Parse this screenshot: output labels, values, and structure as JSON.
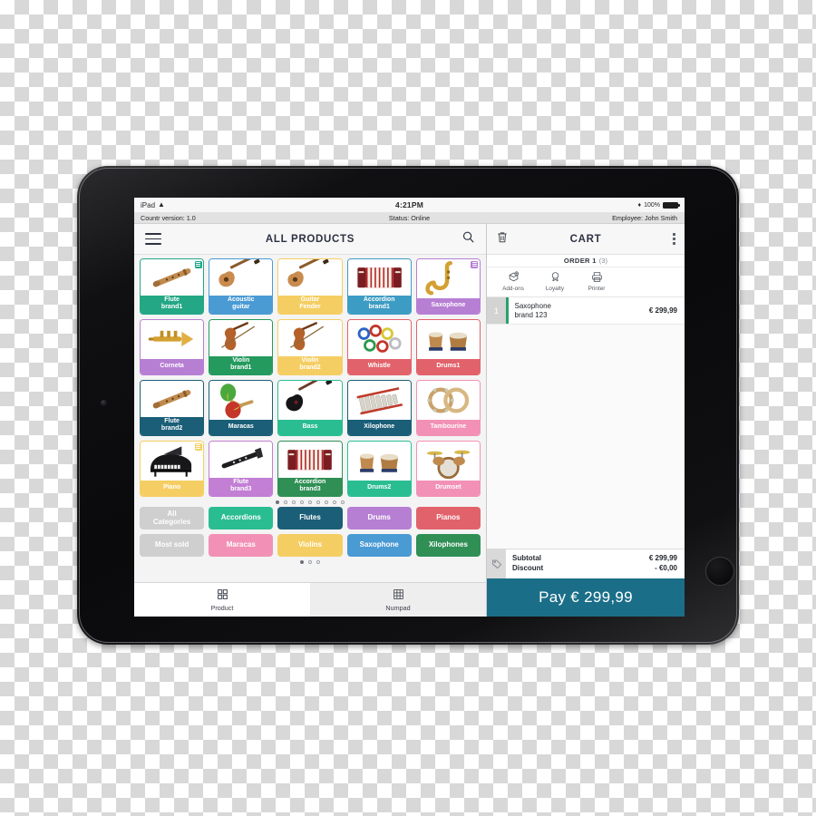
{
  "status_bar": {
    "device": "iPad",
    "wifi_icon": "wifi-icon",
    "time": "4:21PM",
    "bluetooth_icon": "bluetooth-icon",
    "battery_percent": "100%"
  },
  "info_bar": {
    "version": "Countr version: 1.0",
    "status": "Status: Online",
    "employee": "Employee: John Smith"
  },
  "products_panel": {
    "menu_icon": "hamburger-menu-icon",
    "title": "ALL PRODUCTS",
    "search_icon": "search-icon",
    "tiles": [
      {
        "label": "Flute\nbrand1",
        "color": "#23a785",
        "border": "#23a785",
        "badge": true,
        "icon": "flute"
      },
      {
        "label": "Acoustic\nguitar",
        "color": "#4a9ad4",
        "border": "#4a9ad4",
        "badge": false,
        "icon": "guitar"
      },
      {
        "label": "Guitar\nFender",
        "color": "#f5ce63",
        "border": "#f5ce63",
        "badge": false,
        "icon": "guitar"
      },
      {
        "label": "Accordion\nbrand1",
        "color": "#3d9cc4",
        "border": "#3d9cc4",
        "badge": false,
        "icon": "accordion"
      },
      {
        "label": "Saxophone",
        "color": "#b77fd4",
        "border": "#b77fd4",
        "badge": true,
        "icon": "sax"
      },
      {
        "label": "Corneta",
        "color": "#b77fd4",
        "border": "#b77fd4",
        "badge": false,
        "icon": "trumpet"
      },
      {
        "label": "Violin\nbrand1",
        "color": "#249a5e",
        "border": "#249a5e",
        "badge": false,
        "icon": "violin"
      },
      {
        "label": "Violin\nbrand2",
        "color": "#f5ce63",
        "border": "#f5ce63",
        "badge": false,
        "icon": "violin"
      },
      {
        "label": "Whistle",
        "color": "#e2626b",
        "border": "#e2626b",
        "badge": false,
        "icon": "whistle"
      },
      {
        "label": "Drums1",
        "color": "#e2626b",
        "border": "#e2626b",
        "badge": false,
        "icon": "tabla"
      },
      {
        "label": "Flute\nbrand2",
        "color": "#1b5e78",
        "border": "#1b5e78",
        "badge": false,
        "icon": "flute"
      },
      {
        "label": "Maracas",
        "color": "#1b5e78",
        "border": "#1b5e78",
        "badge": false,
        "icon": "maracas"
      },
      {
        "label": "Bass",
        "color": "#2bbd92",
        "border": "#2bbd92",
        "badge": false,
        "icon": "bass"
      },
      {
        "label": "Xilophone",
        "color": "#1b5e78",
        "border": "#1b5e78",
        "badge": false,
        "icon": "xylophone"
      },
      {
        "label": "Tambourine",
        "color": "#f291b5",
        "border": "#f291b5",
        "badge": false,
        "icon": "tambourine"
      },
      {
        "label": "Piano",
        "color": "#f5ce63",
        "border": "#f5ce63",
        "badge": true,
        "icon": "piano"
      },
      {
        "label": "Flute\nbrand3",
        "color": "#c27fd4",
        "border": "#c27fd4",
        "badge": false,
        "icon": "clarinet"
      },
      {
        "label": "Accordion\nbrand3",
        "color": "#2f8f55",
        "border": "#2f8f55",
        "badge": false,
        "icon": "accordion"
      },
      {
        "label": "Drums2",
        "color": "#2bbd92",
        "border": "#2bbd92",
        "badge": false,
        "icon": "tabla"
      },
      {
        "label": "Drumset",
        "color": "#f291b5",
        "border": "#f291b5",
        "badge": false,
        "icon": "drumset"
      }
    ],
    "grid_pager": {
      "count": 9,
      "active": 0
    },
    "categories": [
      {
        "label": "All\nCategories",
        "color": "#cfcfcf"
      },
      {
        "label": "Accordions",
        "color": "#2bbd92"
      },
      {
        "label": "Flutes",
        "color": "#1b5e78"
      },
      {
        "label": "Drums",
        "color": "#b77fd4"
      },
      {
        "label": "Pianos",
        "color": "#e2626b"
      },
      {
        "label": "Most sold",
        "color": "#cfcfcf"
      },
      {
        "label": "Maracas",
        "color": "#f291b5"
      },
      {
        "label": "Violins",
        "color": "#f5ce63"
      },
      {
        "label": "Saxophone",
        "color": "#4a9ad4"
      },
      {
        "label": "Xilophones",
        "color": "#2f8f55"
      }
    ],
    "category_pager": {
      "count": 3,
      "active": 0
    },
    "tabs": [
      {
        "label": "Product",
        "icon": "grid-icon",
        "active": false
      },
      {
        "label": "Numpad",
        "icon": "numpad-icon",
        "active": true
      }
    ]
  },
  "cart_panel": {
    "trash_icon": "trash-icon",
    "title": "CART",
    "more_icon": "kebab-menu-icon",
    "order_label": "ORDER 1",
    "order_count": "(3)",
    "actions": [
      {
        "label": "Add-ons",
        "icon": "addons-icon"
      },
      {
        "label": "Loyalty",
        "icon": "loyalty-icon"
      },
      {
        "label": "Printer",
        "icon": "printer-icon"
      }
    ],
    "items": [
      {
        "qty": "1",
        "name_line1": "Saxophone",
        "name_line2": "brand 123",
        "price": "€ 299,99"
      }
    ],
    "totals_icon": "tag-icon",
    "totals": [
      {
        "label": "Subtotal",
        "value": "€ 299,99"
      },
      {
        "label": "Discount",
        "value": "- €0,00"
      }
    ],
    "pay_label": "Pay € 299,99",
    "pay_color": "#1b6e88"
  }
}
